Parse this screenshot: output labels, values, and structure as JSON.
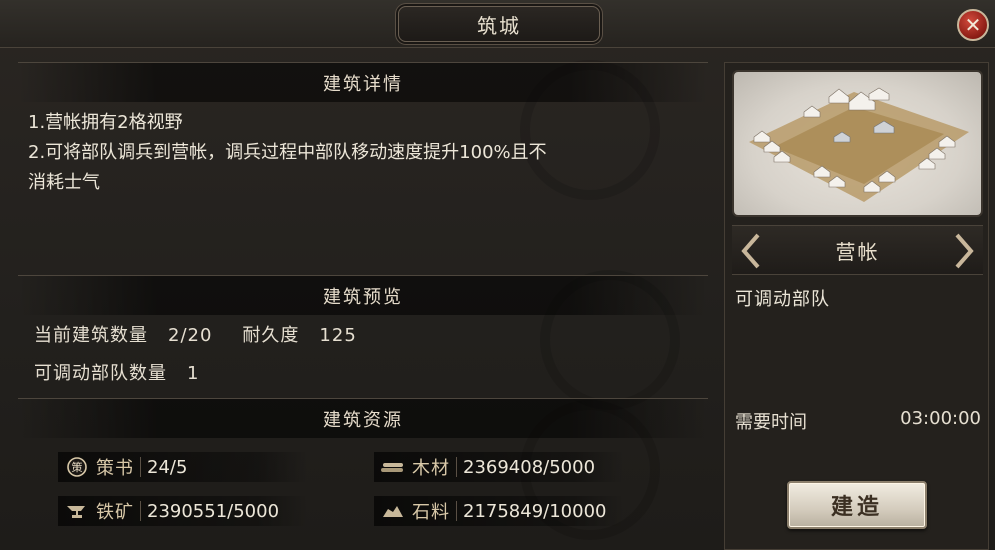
{
  "window": {
    "title": "筑城",
    "close_icon": "close-icon"
  },
  "details": {
    "header": "建筑详情",
    "lines": [
      "1.营帐拥有2格视野",
      "2.可将部队调兵到营帐，调兵过程中部队移动速度提升100%且不",
      "消耗士气"
    ]
  },
  "preview": {
    "header": "建筑预览",
    "count_label": "当前建筑数量",
    "count_value": "2/20",
    "durability_label": "耐久度",
    "durability_value": "125",
    "troops_label": "可调动部队数量",
    "troops_value": "1"
  },
  "resources": {
    "header": "建筑资源",
    "items": [
      {
        "icon": "strategy-book-icon",
        "label": "策书",
        "value": "24/5"
      },
      {
        "icon": "wood-icon",
        "label": "木材",
        "value": "2369408/5000"
      },
      {
        "icon": "iron-anvil-icon",
        "label": "铁矿",
        "value": "2390551/5000"
      },
      {
        "icon": "stone-icon",
        "label": "石料",
        "value": "2175849/10000"
      }
    ]
  },
  "building": {
    "name": "营帐",
    "feature": "可调动部队",
    "time_label": "需要时间",
    "time_value": "03:00:00",
    "build_label": "建造"
  },
  "colors": {
    "accent_gold": "#d8c8a8",
    "close_red": "#b02a1e",
    "button_face": "#e6dfd0"
  }
}
